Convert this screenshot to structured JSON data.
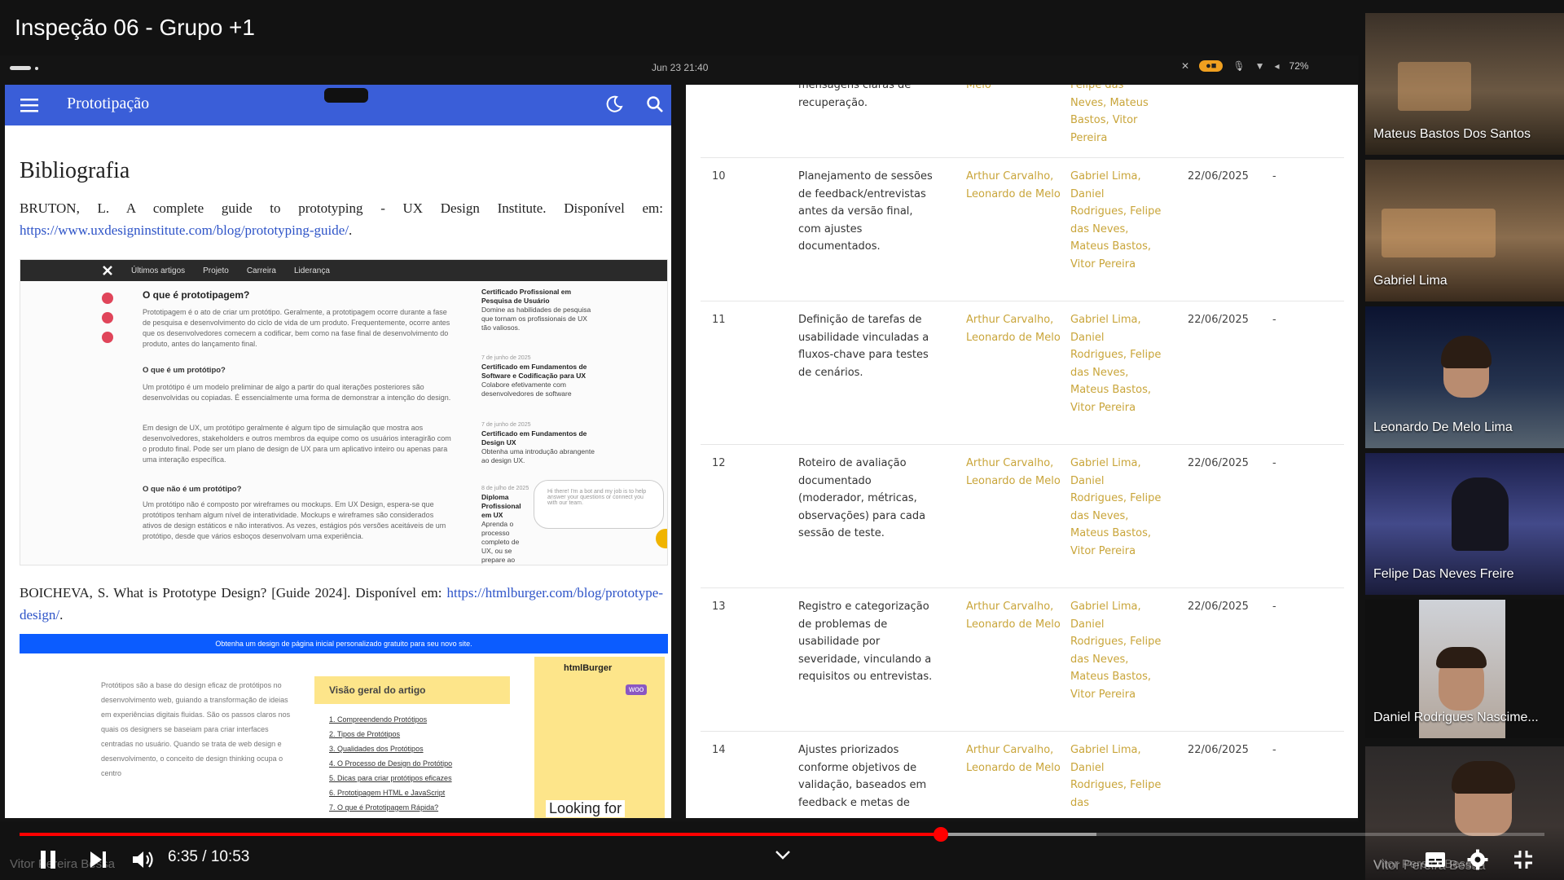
{
  "video": {
    "title": "Inspeção 06 - Grupo +1",
    "current_time": "6:35",
    "duration": "10:53",
    "time_display": "6:35 / 10:53",
    "progress_fraction": 0.604
  },
  "status_bar": {
    "datetime": "Jun 23  21:40",
    "battery": "72%"
  },
  "left_pane": {
    "app_title": "Prototipação",
    "section_title": "Bibliografia",
    "ref1": {
      "text": "BRUTON, L. A complete guide to prototyping - UX Design Institute. Disponível em: ",
      "link": "https://www.uxdesigninstitute.com/blog/prototyping-guide/",
      "trail": "."
    },
    "shot1": {
      "nav_items": [
        "Últimos artigos",
        "Projeto",
        "Carreira",
        "Liderança"
      ],
      "heading": "O que é prototipagem?",
      "para1": "Prototipagem é o ato de criar um protótipo. Geralmente, a prototipagem ocorre durante a fase de pesquisa e desenvolvimento do ciclo de vida de um produto. Frequentemente, ocorre antes que os desenvolvedores comecem a codificar, bem como na fase final de desenvolvimento do produto, antes do lançamento final.",
      "sub1": "O que é um protótipo?",
      "para2": "Um protótipo é um modelo preliminar de algo a partir do qual iterações posteriores são desenvolvidas ou copiadas. É essencialmente uma forma de demonstrar a intenção do design.",
      "para3": "Em design de UX, um protótipo geralmente é algum tipo de simulação que mostra aos desenvolvedores, stakeholders e outros membros da equipe como os usuários interagirão com o produto final. Pode ser um plano de design de UX para um aplicativo inteiro ou apenas para uma interação específica.",
      "sub2": "O que não é um protótipo?",
      "para4": "Um protótipo não é composto por wireframes ou mockups. Em UX Design, espera-se que protótipos tenham algum nível de interatividade. Mockups e wireframes são considerados ativos de design estáticos e não interativos. As vezes, estágios pós versões aceitáveis de um protótipo, desde que vários esboços desenvolvam uma experiência.",
      "side": [
        {
          "title": "Certificado Profissional em Pesquisa de Usuário",
          "text": "Domine as habilidades de pesquisa que tornam os profissionais de UX tão valiosos."
        },
        {
          "title": "Certificado em Fundamentos de Software e Codificação para UX",
          "date": "7 de junho de 2025",
          "text": "Colabore efetivamente com desenvolvedores de software"
        },
        {
          "title": "Certificado em Fundamentos de Design UX",
          "date": "7 de junho de 2025",
          "text": "Obtenha uma introdução abrangente ao design UX."
        },
        {
          "title": "Diploma Profissional em UX",
          "date": "8 de julho de 2025",
          "text": "Aprenda o processo completo de UX, ou se prepare ao design"
        }
      ],
      "chat_text": "Hi there! I'm a bot and my job is to help answer your questions or connect you with our team."
    },
    "ref2": {
      "text": "BOICHEVA, S. What is Prototype Design? [Guide 2024]. Disponível em: ",
      "link": "https://htmlburger.com/blog/prototype-design/",
      "trail": "."
    },
    "shot2": {
      "banner": "Obtenha um design de página inicial personalizado gratuito para seu novo site.",
      "para": "Protótipos são a base do design eficaz de protótipos no desenvolvimento web, guiando a transformação de ideias em experiências digitais fluidas. São os passos claros nos quais os designers se baseiam para criar interfaces centradas no usuário. Quando se trata de web design e desenvolvimento, o conceito de design thinking ocupa o centro",
      "toc_title": "Visão geral do artigo",
      "toc": [
        "1. Compreendendo Protótipos",
        "2. Tipos de Protótipos",
        "3. Qualidades dos Protótipos",
        "4. O Processo de Design do Protótipo",
        "5. Dicas para criar protótipos eficazes",
        "6. Prototipagem HTML e JavaScript",
        "7. O que é Prototipagem Rápida?"
      ],
      "brand": "htmlBurger",
      "woo": "woo",
      "promo_text": "Looking for"
    }
  },
  "table": {
    "first_row": {
      "desc": "mensagens claras de recuperação.",
      "resp": "Melo",
      "part": "Felipe das Neves, Mateus Bastos, Vitor Pereira"
    },
    "rows": [
      {
        "num": "10",
        "desc": "Planejamento de sessões de feedback/entrevistas antes da versão final, com ajustes documentados.",
        "resp": "Arthur Carvalho, Leonardo de Melo",
        "part": "Gabriel Lima, Daniel Rodrigues, Felipe das Neves, Mateus Bastos, Vitor Pereira",
        "date": "22/06/2025",
        "obs": "-"
      },
      {
        "num": "11",
        "desc": "Definição de tarefas de usabilidade vinculadas a fluxos-chave para testes de cenários.",
        "resp": "Arthur Carvalho, Leonardo de Melo",
        "part": "Gabriel Lima, Daniel Rodrigues, Felipe das Neves, Mateus Bastos, Vitor Pereira",
        "date": "22/06/2025",
        "obs": "-"
      },
      {
        "num": "12",
        "desc": "Roteiro de avaliação documentado (moderador, métricas, observações) para cada sessão de teste.",
        "resp": "Arthur Carvalho, Leonardo de Melo",
        "part": "Gabriel Lima, Daniel Rodrigues, Felipe das Neves, Mateus Bastos, Vitor Pereira",
        "date": "22/06/2025",
        "obs": "-"
      },
      {
        "num": "13",
        "desc": "Registro e categorização de problemas de usabilidade por severidade, vinculando a requisitos ou entrevistas.",
        "resp": "Arthur Carvalho, Leonardo de Melo",
        "part": "Gabriel Lima, Daniel Rodrigues, Felipe das Neves, Mateus Bastos, Vitor Pereira",
        "date": "22/06/2025",
        "obs": "-"
      },
      {
        "num": "14",
        "desc": "Ajustes priorizados conforme objetivos de validação, baseados em feedback e metas de",
        "resp": "Arthur Carvalho, Leonardo de Melo",
        "part": "Gabriel Lima, Daniel Rodrigues, Felipe das",
        "date": "22/06/2025",
        "obs": "-"
      }
    ]
  },
  "participants": [
    "Mateus Bastos Dos Santos",
    "Gabriel Lima",
    "Leonardo De Melo Lima",
    "Felipe Das Neves Freire",
    "Daniel Rodrigues Nascime...",
    "Vitor Pereira Bessa"
  ],
  "caption_ghost": {
    "left": "Vitor Pereira Bessa",
    "right": "Vitor Pereira Bessa"
  },
  "colors": {
    "accent_red": "#ff0000",
    "appbar_blue": "#3a5ed8",
    "link_blue": "#2e54c8",
    "name_gold": "#c9a53a"
  }
}
